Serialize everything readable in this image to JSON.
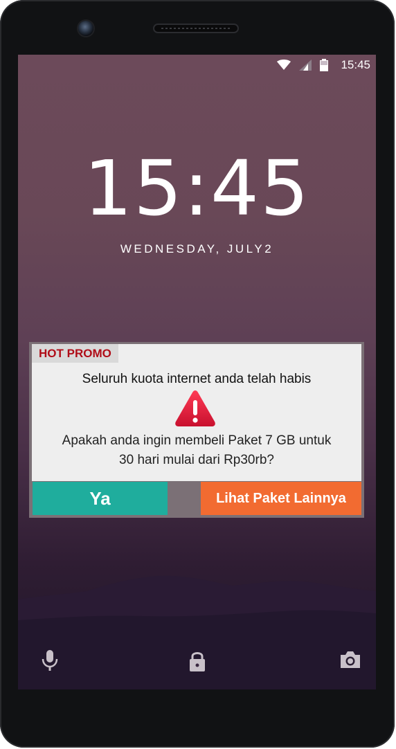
{
  "status_bar": {
    "time": "15:45",
    "icons": [
      "wifi-icon",
      "signal-icon",
      "battery-icon"
    ]
  },
  "lockscreen": {
    "time_hours": "15",
    "time_separator": ":",
    "time_minutes": "45",
    "date": "WEDNESDAY, JULY2"
  },
  "promo": {
    "tag": "HOT PROMO",
    "message": "Seluruh kuota internet anda telah habis",
    "question_line1": "Apakah anda ingin membeli Paket 7 GB untuk",
    "question_line2": "30 hari mulai dari Rp30rb?",
    "yes_label": "Ya",
    "more_label": "Lihat Paket Lainnya",
    "tag_color": "#b00d18",
    "yes_color": "#1fad9d",
    "more_color": "#f26b31",
    "warning_icon": "warning-icon"
  },
  "shortcuts": {
    "left": "microphone-icon",
    "center": "lock-icon",
    "right": "camera-icon"
  }
}
